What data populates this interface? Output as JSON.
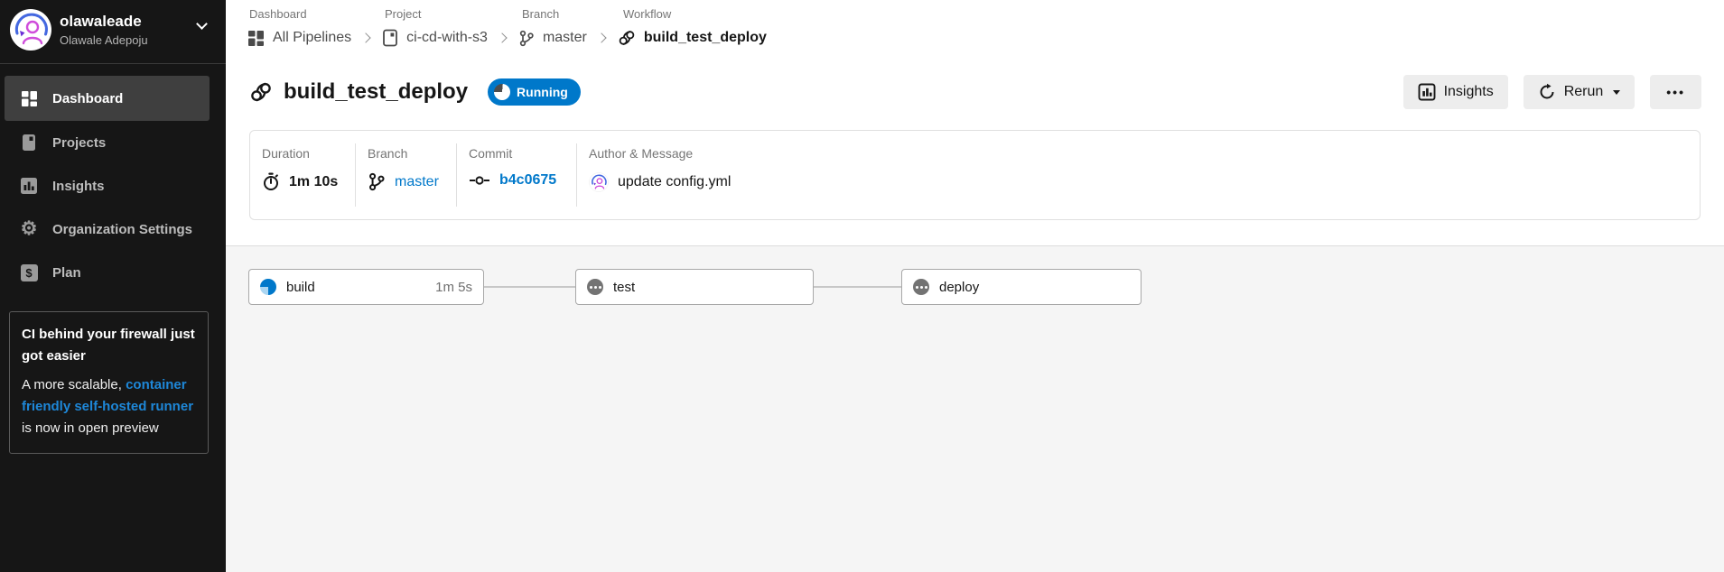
{
  "sidebar": {
    "org_name": "olawaleade",
    "user_name": "Olawale Adepoju",
    "items": [
      {
        "label": "Dashboard",
        "icon": "dashboard-grid-icon",
        "active": true
      },
      {
        "label": "Projects",
        "icon": "projects-icon",
        "active": false
      },
      {
        "label": "Insights",
        "icon": "insights-bars-icon",
        "active": false
      },
      {
        "label": "Organization Settings",
        "icon": "gear-icon",
        "active": false
      },
      {
        "label": "Plan",
        "icon": "dollar-square-icon",
        "active": false
      }
    ],
    "promo": {
      "title": "CI behind your firewall just got easier",
      "body_prefix": "A more scalable, ",
      "link_text": "container friendly self-hosted runner",
      "body_suffix": " is now in open preview"
    }
  },
  "breadcrumb": {
    "labels": [
      "Dashboard",
      "Project",
      "Branch",
      "Workflow"
    ],
    "items": [
      {
        "label": "All Pipelines",
        "icon": "grid-icon"
      },
      {
        "label": "ci-cd-with-s3",
        "icon": "project-icon"
      },
      {
        "label": "master",
        "icon": "branch-icon"
      },
      {
        "label": "build_test_deploy",
        "icon": "workflow-icon"
      }
    ]
  },
  "header": {
    "title": "build_test_deploy",
    "status_badge": "Running",
    "insights_label": "Insights",
    "rerun_label": "Rerun",
    "more_label": "•••"
  },
  "summary": {
    "duration": {
      "label": "Duration",
      "value": "1m 10s"
    },
    "branch": {
      "label": "Branch",
      "value": "master"
    },
    "commit": {
      "label": "Commit",
      "value": "b4c0675"
    },
    "author": {
      "label": "Author & Message",
      "value": "update config.yml"
    }
  },
  "workflow": {
    "jobs": [
      {
        "name": "build",
        "status": "running",
        "duration": "1m 5s"
      },
      {
        "name": "test",
        "status": "pending",
        "duration": ""
      },
      {
        "name": "deploy",
        "status": "pending",
        "duration": ""
      }
    ]
  },
  "colors": {
    "accent_blue": "#0078ca",
    "running_badge": "#0078ca",
    "link_blue": "#0078ca",
    "promo_link_blue": "#1e87d8",
    "sidebar_bg": "#161616",
    "canvas_grey": "#f5f5f5"
  }
}
